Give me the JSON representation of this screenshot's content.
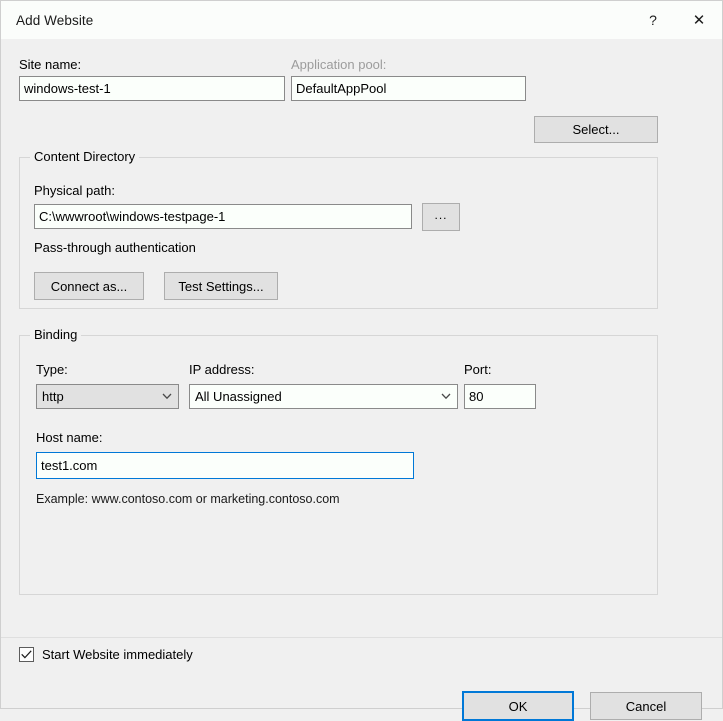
{
  "window": {
    "title": "Add Website",
    "help_button": "?",
    "close_button": "✕"
  },
  "site": {
    "site_name_label": "Site name:",
    "site_name_value": "windows-test-1",
    "app_pool_label": "Application pool:",
    "app_pool_value": "DefaultAppPool",
    "select_button": "Select..."
  },
  "content_directory": {
    "legend": "Content Directory",
    "physical_path_label": "Physical path:",
    "physical_path_value": "C:\\wwwroot\\windows-testpage-1",
    "browse_button": "...",
    "auth_text": "Pass-through authentication",
    "connect_as_button": "Connect as...",
    "test_settings_button": "Test Settings..."
  },
  "binding": {
    "legend": "Binding",
    "type_label": "Type:",
    "type_value": "http",
    "ip_label": "IP address:",
    "ip_value": "All Unassigned",
    "port_label": "Port:",
    "port_value": "80",
    "host_label": "Host name:",
    "host_value": "test1.com",
    "example_text": "Example: www.contoso.com or marketing.contoso.com"
  },
  "footer": {
    "start_checkbox_label": "Start Website immediately",
    "start_checkbox_checked": true,
    "ok_button": "OK",
    "cancel_button": "Cancel"
  },
  "colors": {
    "accent": "#0078d7",
    "dialog_bg": "#f0f0f0",
    "titlebar_bg": "#fbfdfb",
    "field_bg": "#fbfffb",
    "disabled_label": "#9c9c9c"
  }
}
